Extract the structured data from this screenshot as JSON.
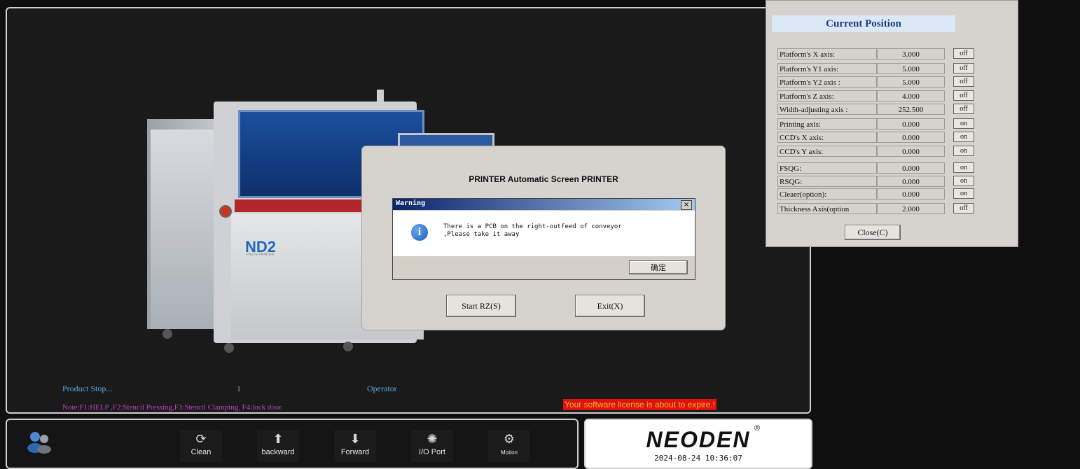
{
  "main_dialog": {
    "title": "PRINTER Automatic Screen PRINTER",
    "start_button": "Start RZ(S)",
    "exit_button": "Exit(X)"
  },
  "warning": {
    "title": "Warning",
    "message_line1": "There is a PCB on the right-outfeed of conveyor",
    "message_line2": ",Please take it away",
    "ok_button": "确定",
    "close_glyph": "×",
    "icon_glyph": "i"
  },
  "position_panel": {
    "title": "Current Position",
    "rows": [
      {
        "label": "Platform's X axis:",
        "value": "3.000",
        "state": "off"
      },
      {
        "label": "Platform's Y1 axis:",
        "value": "5.000",
        "state": "off"
      },
      {
        "label": "Platform's Y2 axis :",
        "value": "5.000",
        "state": "off"
      },
      {
        "label": "Platform's Z axis:",
        "value": "4.000",
        "state": "off"
      },
      {
        "label": "Width-adjusting axis :",
        "value": "252.500",
        "state": "off"
      },
      {
        "label": "Printing axis:",
        "value": "0.000",
        "state": "on"
      },
      {
        "label": "CCD's X axis:",
        "value": "0.000",
        "state": "on"
      },
      {
        "label": "CCD's Y axis:",
        "value": "0.000",
        "state": "on"
      },
      {
        "label": "FSQG:",
        "value": "0.000",
        "state": "on"
      },
      {
        "label": "RSQG:",
        "value": "0.000",
        "state": "on"
      },
      {
        "label": "Cleaer(option):",
        "value": "0.000",
        "state": "on"
      },
      {
        "label": "Thickness Axis(option",
        "value": "2.000",
        "state": "off"
      }
    ],
    "close_button": "Close(C)"
  },
  "status": {
    "product_state": "Product Stop...",
    "count": "1",
    "role": "Operator",
    "note": "Note:F1:HELP ,F2:Stencil Pressing,F3:Stencil  Clamping, F4:lock door",
    "license": "Your software license is about to expire.!"
  },
  "machine": {
    "model": "ND2",
    "subtitle": "PASTE PRINTER"
  },
  "toolbar": {
    "clean": "Clean",
    "backward": "backward",
    "forward": "Forward",
    "io_port": "I/O Port",
    "motion": "Motion"
  },
  "brand": {
    "logo": "NEODEN",
    "registered": "®",
    "datetime": "2024-08-24  10:36:07"
  }
}
